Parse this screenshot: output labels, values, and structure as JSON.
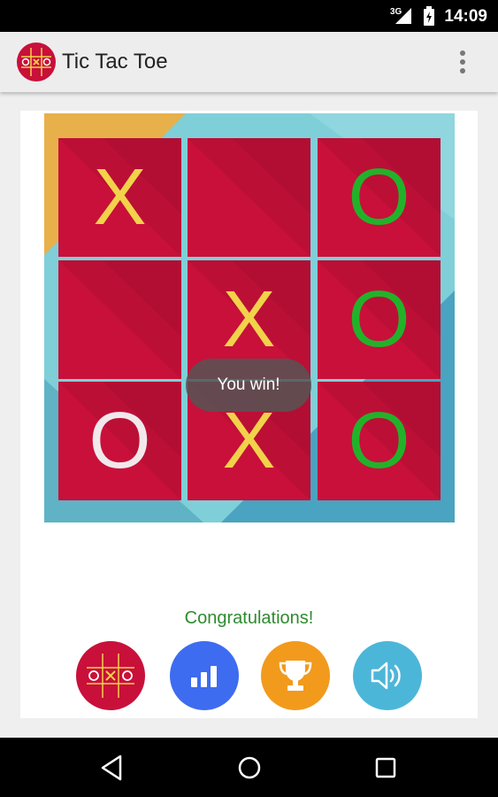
{
  "status_bar": {
    "network": "3G",
    "time": "14:09"
  },
  "app_bar": {
    "title": "Tic Tac Toe",
    "logo_icon": "tic-tac-toe-logo-icon",
    "menu_icon": "overflow-menu-icon"
  },
  "board": {
    "cells": [
      {
        "mark": "X",
        "color": "#f2d24a"
      },
      {
        "mark": "",
        "color": ""
      },
      {
        "mark": "O",
        "color": "#22b22a"
      },
      {
        "mark": "",
        "color": ""
      },
      {
        "mark": "X",
        "color": "#f2d24a"
      },
      {
        "mark": "O",
        "color": "#22b22a"
      },
      {
        "mark": "O",
        "color": "#f1e8ec"
      },
      {
        "mark": "X",
        "color": "#f2d24a"
      },
      {
        "mark": "O",
        "color": "#22b22a"
      }
    ]
  },
  "toast": {
    "text": "You win!"
  },
  "message": {
    "text": "Congratulations!"
  },
  "actions": [
    {
      "name": "new-game-button",
      "icon": "oxo-grid-icon",
      "color": "#c8103a"
    },
    {
      "name": "leaderboard-button",
      "icon": "bar-chart-icon",
      "color": "#3d6cf0"
    },
    {
      "name": "achievements-button",
      "icon": "trophy-icon",
      "color": "#f29a1c"
    },
    {
      "name": "sound-button",
      "icon": "speaker-icon",
      "color": "#4cb6d9"
    }
  ],
  "nav": {
    "back_icon": "back-icon",
    "home_icon": "home-icon",
    "recents_icon": "recents-icon"
  }
}
